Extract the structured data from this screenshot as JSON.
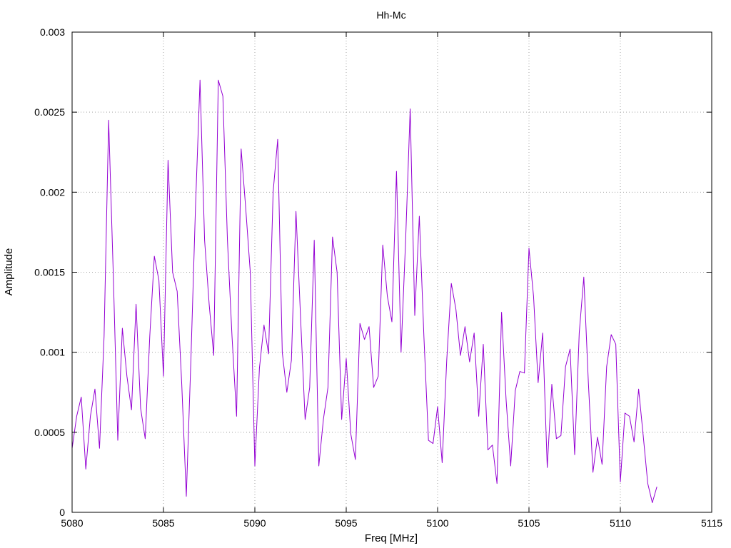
{
  "chart_data": {
    "type": "line",
    "title": "Hh-Mc",
    "xlabel": "Freq [MHz]",
    "ylabel": "Amplitude",
    "xlim": [
      5080,
      5115
    ],
    "ylim": [
      0,
      0.003
    ],
    "xticks": [
      5080,
      5085,
      5090,
      5095,
      5100,
      5105,
      5110,
      5115
    ],
    "xtick_labels": [
      "5080",
      "5085",
      "5090",
      "5095",
      "5100",
      "5105",
      "5110",
      "5115"
    ],
    "yticks": [
      0,
      0.0005,
      0.001,
      0.0015,
      0.002,
      0.0025,
      0.003
    ],
    "ytick_labels": [
      "0",
      "0.0005",
      "0.001",
      "0.0015",
      "0.002",
      "0.0025",
      "0.003"
    ],
    "grid": true,
    "series": [
      {
        "color": "#9400d3",
        "x": [
          5080.0,
          5080.25,
          5080.5,
          5080.75,
          5081.0,
          5081.25,
          5081.5,
          5081.75,
          5082.0,
          5082.25,
          5082.5,
          5082.75,
          5083.0,
          5083.25,
          5083.5,
          5083.75,
          5084.0,
          5084.25,
          5084.5,
          5084.75,
          5085.0,
          5085.25,
          5085.5,
          5085.75,
          5086.0,
          5086.25,
          5086.5,
          5086.75,
          5087.0,
          5087.25,
          5087.5,
          5087.75,
          5088.0,
          5088.25,
          5088.5,
          5088.75,
          5089.0,
          5089.25,
          5089.5,
          5089.75,
          5090.0,
          5090.25,
          5090.5,
          5090.75,
          5091.0,
          5091.25,
          5091.5,
          5091.75,
          5092.0,
          5092.25,
          5092.5,
          5092.75,
          5093.0,
          5093.25,
          5093.5,
          5093.75,
          5094.0,
          5094.25,
          5094.5,
          5094.75,
          5095.0,
          5095.25,
          5095.5,
          5095.75,
          5096.0,
          5096.25,
          5096.5,
          5096.75,
          5097.0,
          5097.25,
          5097.5,
          5097.75,
          5098.0,
          5098.25,
          5098.5,
          5098.75,
          5099.0,
          5099.25,
          5099.5,
          5099.75,
          5100.0,
          5100.25,
          5100.5,
          5100.75,
          5101.0,
          5101.25,
          5101.5,
          5101.75,
          5102.0,
          5102.25,
          5102.5,
          5102.75,
          5103.0,
          5103.25,
          5103.5,
          5103.75,
          5104.0,
          5104.25,
          5104.5,
          5104.75,
          5105.0,
          5105.25,
          5105.5,
          5105.75,
          5106.0,
          5106.25,
          5106.5,
          5106.75,
          5107.0,
          5107.25,
          5107.5,
          5107.75,
          5108.0,
          5108.25,
          5108.5,
          5108.75,
          5109.0,
          5109.25,
          5109.5,
          5109.75,
          5110.0,
          5110.25,
          5110.5,
          5110.75,
          5111.0,
          5111.25,
          5111.5,
          5111.75,
          5112.0
        ],
        "y": [
          0.0004,
          0.0006,
          0.00072,
          0.00027,
          0.0006,
          0.00077,
          0.0004,
          0.0011,
          0.00245,
          0.0015,
          0.00045,
          0.00115,
          0.00085,
          0.00064,
          0.0013,
          0.00065,
          0.00046,
          0.0011,
          0.0016,
          0.00145,
          0.00085,
          0.0022,
          0.0015,
          0.00138,
          0.0008,
          0.0001,
          0.00095,
          0.0019,
          0.0027,
          0.0017,
          0.0013,
          0.00098,
          0.0027,
          0.0026,
          0.0017,
          0.0011,
          0.0006,
          0.00227,
          0.0019,
          0.0015,
          0.00029,
          0.0009,
          0.00117,
          0.00099,
          0.002,
          0.00233,
          0.001,
          0.00075,
          0.00095,
          0.00188,
          0.00122,
          0.00058,
          0.00078,
          0.0017,
          0.00029,
          0.00058,
          0.00078,
          0.00172,
          0.0015,
          0.00058,
          0.00096,
          0.00049,
          0.00033,
          0.00118,
          0.00108,
          0.00116,
          0.00078,
          0.00085,
          0.00167,
          0.00135,
          0.00119,
          0.00213,
          0.001,
          0.0017,
          0.00252,
          0.00123,
          0.00185,
          0.0011,
          0.00045,
          0.00043,
          0.00066,
          0.00031,
          0.00095,
          0.00143,
          0.00127,
          0.00098,
          0.00116,
          0.00094,
          0.00112,
          0.0006,
          0.00105,
          0.00039,
          0.00042,
          0.00018,
          0.00125,
          0.0007,
          0.00029,
          0.00076,
          0.00088,
          0.00087,
          0.00165,
          0.00135,
          0.00081,
          0.00112,
          0.00028,
          0.0008,
          0.00046,
          0.00048,
          0.00091,
          0.00102,
          0.00036,
          0.00112,
          0.00147,
          0.00081,
          0.00025,
          0.00047,
          0.0003,
          0.00091,
          0.00111,
          0.00105,
          0.00019,
          0.00062,
          0.0006,
          0.00044,
          0.00077,
          0.00048,
          0.00018,
          6e-05,
          0.00016
        ]
      }
    ]
  }
}
